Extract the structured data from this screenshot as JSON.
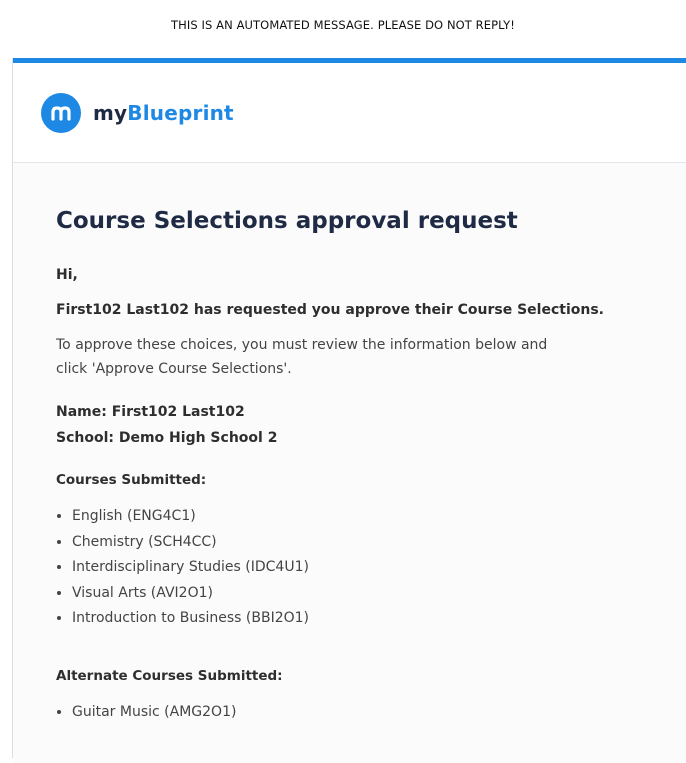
{
  "notice": "THIS IS AN AUTOMATED MESSAGE. PLEASE DO NOT REPLY!",
  "brand": {
    "name_prefix": "my",
    "name_suffix": "Blueprint",
    "icon": "blueprint-logo-icon",
    "accent_color": "#1e88e5"
  },
  "email": {
    "title": "Course Selections approval request",
    "greeting": "Hi,",
    "request_line": "First102 Last102 has requested you approve their Course Selections.",
    "instructions_line1": "To approve these choices, you must review the information below and",
    "instructions_line2": "click 'Approve Course Selections'.",
    "name_line": "Name: First102 Last102",
    "school_line": "School: Demo High School 2",
    "courses_heading": "Courses Submitted:",
    "courses": [
      "English (ENG4C1)",
      "Chemistry (SCH4CC)",
      "Interdisciplinary Studies (IDC4U1)",
      "Visual Arts (AVI2O1)",
      "Introduction to Business (BBI2O1)"
    ],
    "alternates_heading": "Alternate Courses Submitted:",
    "alternates": [
      "Guitar Music (AMG2O1)"
    ]
  }
}
